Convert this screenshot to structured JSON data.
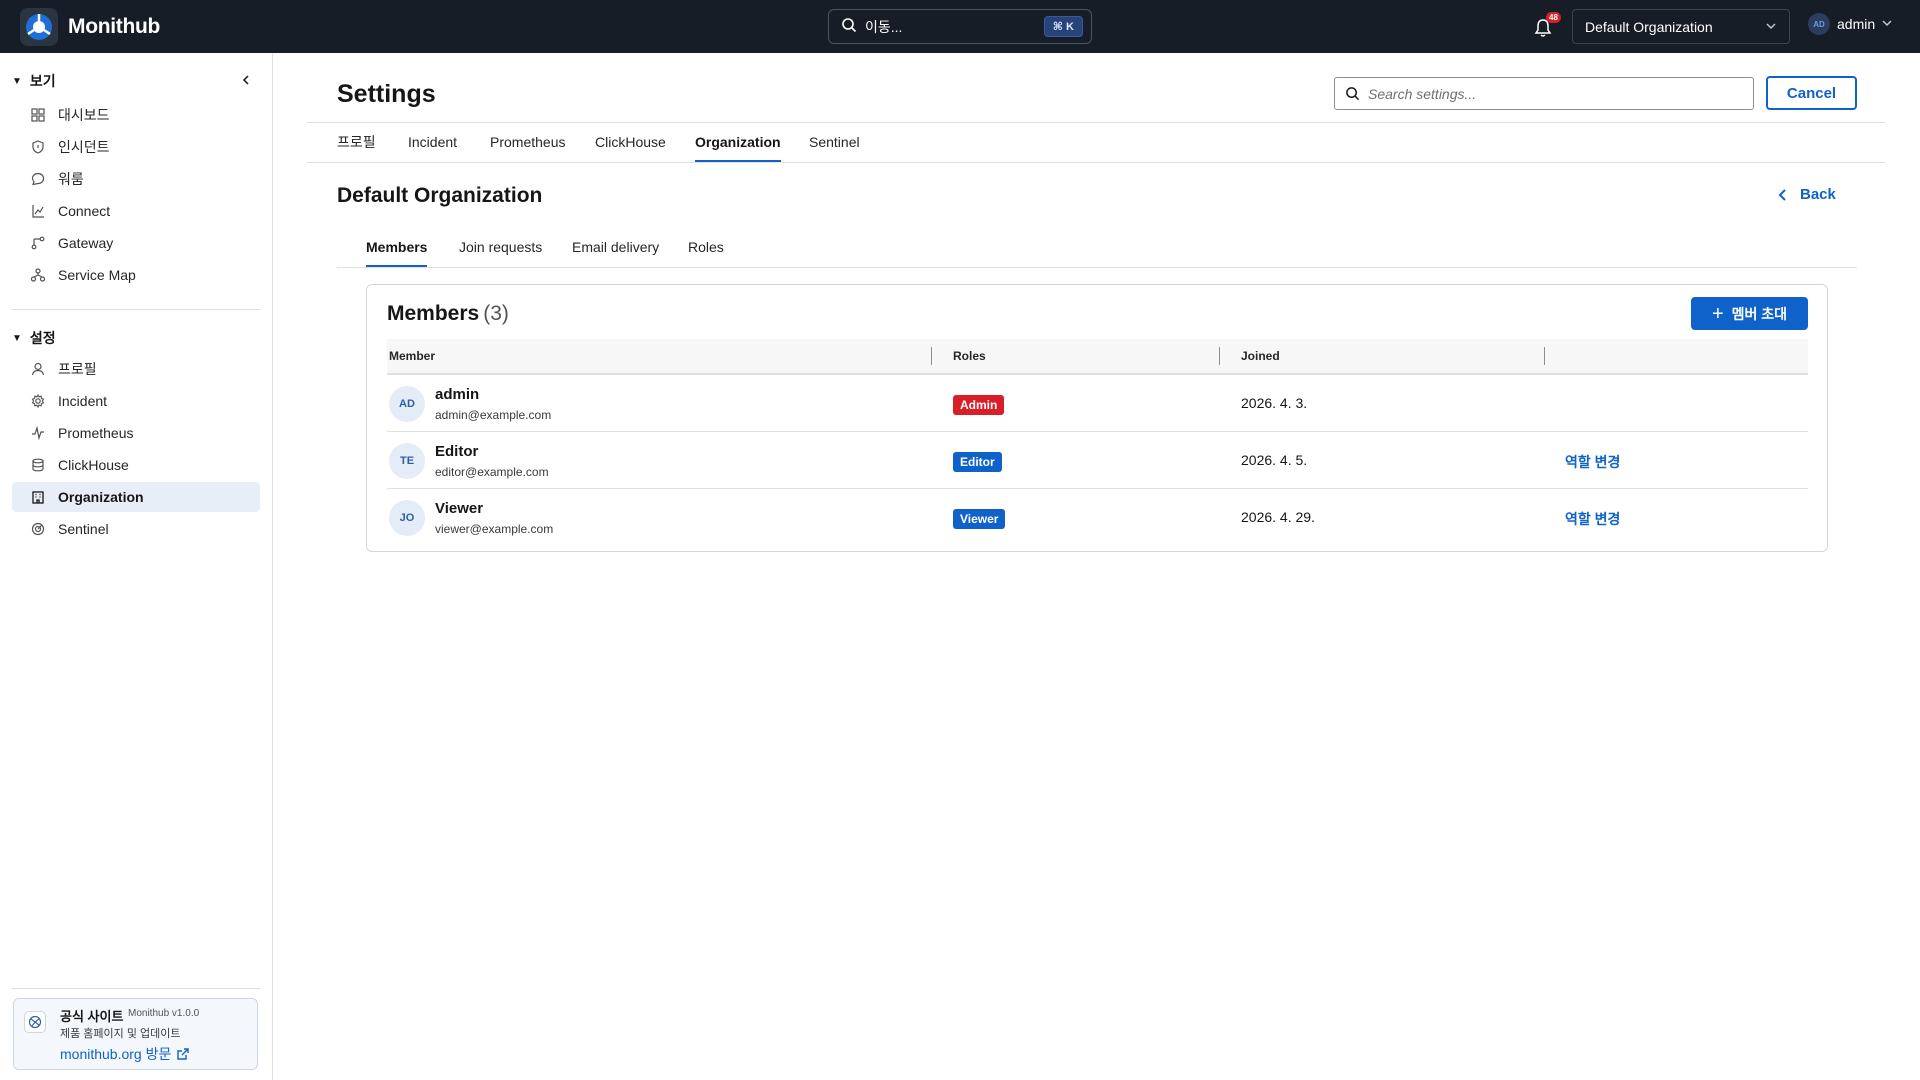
{
  "app": {
    "name": "Monithub"
  },
  "topbar": {
    "search_label": "이동...",
    "search_shortcut": "⌘ K",
    "notification_count": "48",
    "org_selected": "Default Organization",
    "user_initials": "AD",
    "user_name": "admin"
  },
  "sidebar": {
    "view_section": "보기",
    "view_items": [
      {
        "label": "대시보드",
        "icon": "dashboard-icon"
      },
      {
        "label": "인시던트",
        "icon": "shield-icon"
      },
      {
        "label": "워룸",
        "icon": "chat-icon"
      },
      {
        "label": "Connect",
        "icon": "connect-icon"
      },
      {
        "label": "Gateway",
        "icon": "gateway-icon"
      },
      {
        "label": "Service Map",
        "icon": "service-map-icon"
      }
    ],
    "settings_section": "설정",
    "settings_items": [
      {
        "label": "프로필",
        "icon": "user-icon"
      },
      {
        "label": "Incident",
        "icon": "gear-icon"
      },
      {
        "label": "Prometheus",
        "icon": "activity-icon"
      },
      {
        "label": "ClickHouse",
        "icon": "database-icon"
      },
      {
        "label": "Organization",
        "icon": "building-icon",
        "active": true
      },
      {
        "label": "Sentinel",
        "icon": "sentinel-icon"
      }
    ],
    "promo": {
      "title": "공식 사이트",
      "version": "Monithub v1.0.0",
      "description": "제품 홈페이지 및 업데이트",
      "link": "monithub.org 방문"
    }
  },
  "main": {
    "title": "Settings",
    "search_placeholder": "Search settings...",
    "cancel_label": "Cancel",
    "tabs": [
      "프로필",
      "Incident",
      "Prometheus",
      "ClickHouse",
      "Organization",
      "Sentinel"
    ],
    "active_tab": "Organization",
    "org_name": "Default Organization",
    "back_label": "Back",
    "subtabs": [
      "Members",
      "Join requests",
      "Email delivery",
      "Roles"
    ],
    "active_subtab": "Members",
    "members_card": {
      "title": "Members",
      "count": "(3)",
      "invite_label": "멤버 초대",
      "columns": [
        "Member",
        "Roles",
        "Joined"
      ],
      "rows": [
        {
          "initials": "AD",
          "name": "admin",
          "email": "admin@example.com",
          "role": "Admin",
          "role_color": "#da1e28",
          "joined": "2026. 4. 3.",
          "action": ""
        },
        {
          "initials": "TE",
          "name": "Editor",
          "email": "editor@example.com",
          "role": "Editor",
          "role_color": "#0f62c9",
          "joined": "2026. 4. 5.",
          "action": "역할 변경"
        },
        {
          "initials": "JO",
          "name": "Viewer",
          "email": "viewer@example.com",
          "role": "Viewer",
          "role_color": "#0f62c9",
          "joined": "2026. 4. 29.",
          "action": "역할 변경"
        }
      ]
    }
  },
  "colors": {
    "topbar": "#161d27",
    "accent": "#0f62c9",
    "admin_badge": "#da1e28",
    "active_nav": "#e8eef8"
  }
}
